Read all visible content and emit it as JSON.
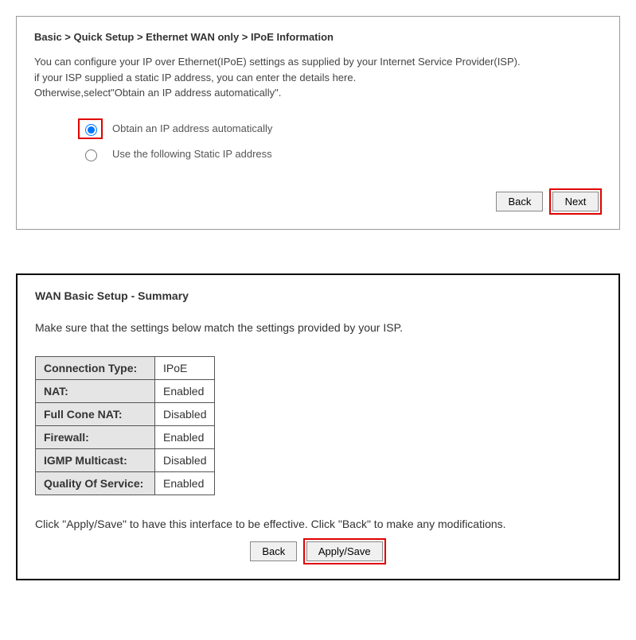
{
  "panel1": {
    "breadcrumb": "Basic > Quick Setup > Ethernet WAN only > IPoE Information",
    "description_line1": "You can configure your IP over Ethernet(IPoE) settings as supplied by your Internet Service Provider(ISP).",
    "description_line2": "if your ISP supplied a static IP address, you can enter the details here.",
    "description_line3": "Otherwise,select\"Obtain an IP address automatically\".",
    "radio_options": {
      "option1_label": "Obtain an IP address automatically",
      "option2_label": "Use the following Static IP address"
    },
    "buttons": {
      "back": "Back",
      "next": "Next"
    }
  },
  "panel2": {
    "title": "WAN Basic Setup - Summary",
    "instruction": "Make sure that the settings below match the settings provided by your ISP.",
    "rows": [
      {
        "label": "Connection Type:",
        "value": "IPoE"
      },
      {
        "label": "NAT:",
        "value": "Enabled"
      },
      {
        "label": "Full Cone NAT:",
        "value": "Disabled"
      },
      {
        "label": "Firewall:",
        "value": "Enabled"
      },
      {
        "label": "IGMP Multicast:",
        "value": "Disabled"
      },
      {
        "label": "Quality Of Service:",
        "value": "Enabled"
      }
    ],
    "post_note": "Click \"Apply/Save\" to have this interface to be effective. Click \"Back\" to make any modifications.",
    "buttons": {
      "back": "Back",
      "apply": "Apply/Save"
    }
  }
}
